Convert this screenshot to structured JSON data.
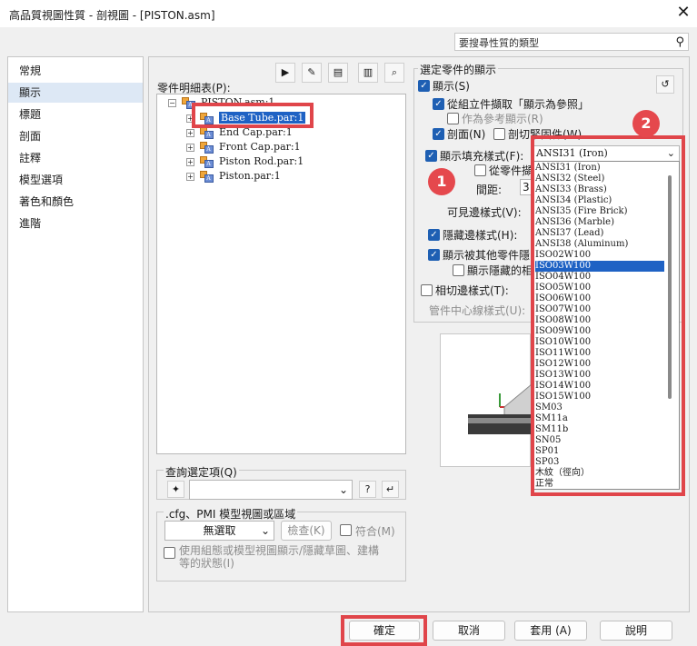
{
  "window": {
    "title": "高品質視圖性質 - 剖視圖 - [PISTON.asm]",
    "close_glyph": "✕"
  },
  "search": {
    "placeholder": "要搜尋性質的類型"
  },
  "nav": {
    "items": [
      "常規",
      "顯示",
      "標題",
      "剖面",
      "註釋",
      "模型選項",
      "著色和顏色",
      "進階"
    ],
    "selected": "顯示"
  },
  "parts_list": {
    "label": "零件明細表(P):",
    "root": "PISTON.asm:1",
    "items": [
      "Base Tube.par:1",
      "End Cap.par:1",
      "Front Cap.par:1",
      "Piston Rod.par:1",
      "Piston.par:1"
    ]
  },
  "query": {
    "label": "查詢選定項(Q)"
  },
  "cfg": {
    "label": ".cfg、PMI 模型視圖或區域",
    "select_value": "無選取",
    "check_button": "檢查(K)",
    "match_label": "符合(M)",
    "state_label": "使用組態或模型視圖顯示/隱藏草圖、建構等的狀態(I)"
  },
  "display": {
    "group_label": "選定零件的顯示",
    "show": "顯示(S)",
    "from_assembly": "從組立件擷取「顯示為參照」",
    "as_reference": "作為參考顯示(R)",
    "section": "剖面(N)",
    "section_fasteners": "剖切緊固件(W)",
    "fill_style": "顯示填充樣式(F):",
    "fill_style_value": "ANSI31 (Iron)",
    "from_part": "從零件擷",
    "spacing": "間距:",
    "spacing_value": "3",
    "visible_edge": "可見邊樣式(V):",
    "hidden_edge": "隱藏邊樣式(H):",
    "hidden_by_others": "顯示被其他零件隱",
    "show_hidden": "顯示隱藏的相",
    "tangent_edge": "相切邊樣式(T):",
    "tube_centerline": "管件中心線樣式(U):"
  },
  "dropdown": {
    "items": [
      "ANSI31 (Iron)",
      "ANSI32 (Steel)",
      "ANSI33 (Brass)",
      "ANSI34 (Plastic)",
      "ANSI35 (Fire Brick)",
      "ANSI36 (Marble)",
      "ANSI37 (Lead)",
      "ANSI38 (Aluminum)",
      "ISO02W100",
      "ISO03W100",
      "ISO04W100",
      "ISO05W100",
      "ISO06W100",
      "ISO07W100",
      "ISO08W100",
      "ISO09W100",
      "ISO10W100",
      "ISO11W100",
      "ISO12W100",
      "ISO13W100",
      "ISO14W100",
      "ISO15W100",
      "SM03",
      "SM11a",
      "SM11b",
      "SN05",
      "SP01",
      "SP03",
      "木紋（徑向）",
      "正常"
    ],
    "highlighted": "ISO03W100"
  },
  "badges": {
    "one": "1",
    "two": "2"
  },
  "buttons": {
    "ok": "確定",
    "cancel": "取消",
    "apply": "套用 (A)",
    "help": "說明"
  },
  "colors": {
    "accent": "#1e5fb3",
    "highlight": "#e0454a"
  }
}
